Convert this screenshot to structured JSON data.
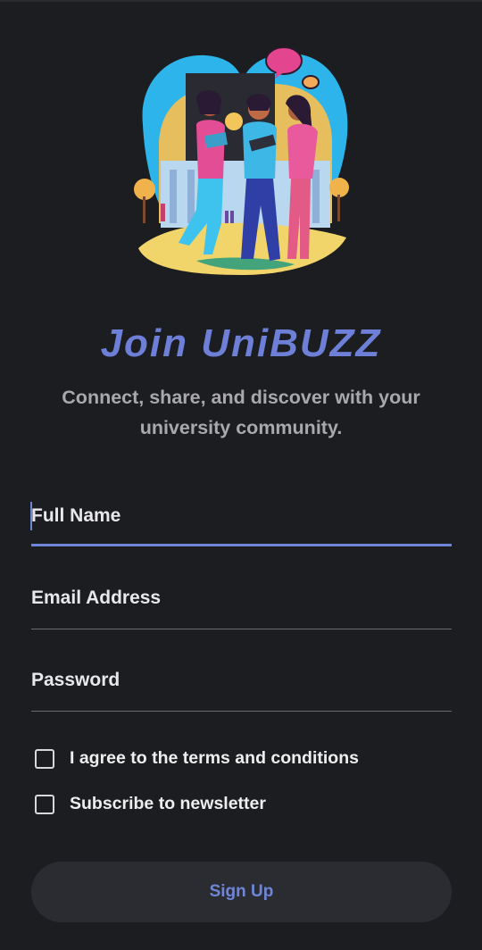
{
  "app": {
    "title": "Join UniBUZZ",
    "subtitle": "Connect, share, and discover with your university community."
  },
  "form": {
    "full_name_label": "Full Name",
    "email_label": "Email Address",
    "password_label": "Password",
    "agree_terms_label": "I agree to the terms and conditions",
    "agree_terms_checked": false,
    "newsletter_label": "Subscribe to newsletter",
    "newsletter_checked": false,
    "submit_label": "Sign Up"
  },
  "colors": {
    "background": "#1c1d20",
    "accent": "#6f86d8",
    "title": "#6d7fd6",
    "button_bg": "#2b2c31"
  },
  "hero": {
    "icon": "students-group-illustration"
  }
}
